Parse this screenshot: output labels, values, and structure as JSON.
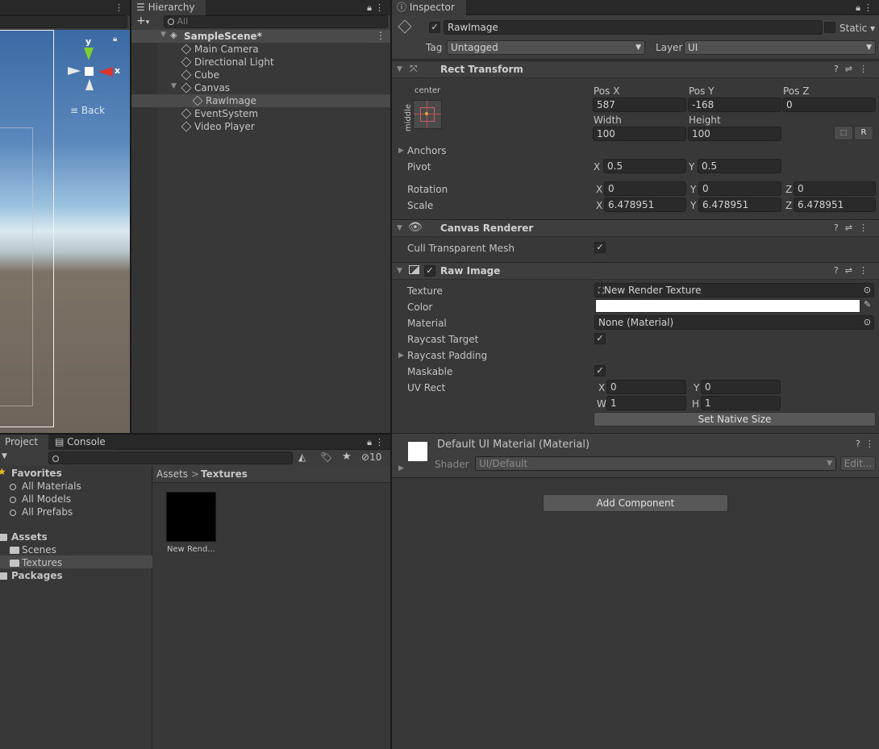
{
  "scene": {
    "axis_y": "y",
    "axis_x": "x",
    "back_label": "Back"
  },
  "hierarchy": {
    "tab": "Hierarchy",
    "search_placeholder": "All",
    "scene_name": "SampleScene*",
    "items": [
      {
        "label": "Main Camera"
      },
      {
        "label": "Directional Light"
      },
      {
        "label": "Cube"
      },
      {
        "label": "Canvas"
      },
      {
        "label": "RawImage"
      },
      {
        "label": "EventSystem"
      },
      {
        "label": "Video Player"
      }
    ]
  },
  "inspector": {
    "tab": "Inspector",
    "object_name": "RawImage",
    "static_label": "Static",
    "tag_label": "Tag",
    "tag_value": "Untagged",
    "layer_label": "Layer",
    "layer_value": "UI",
    "rect_transform": {
      "title": "Rect Transform",
      "anchor_h": "center",
      "anchor_v": "middle",
      "pos_x_label": "Pos X",
      "pos_y_label": "Pos Y",
      "pos_z_label": "Pos Z",
      "pos_x": "587",
      "pos_y": "-168",
      "pos_z": "0",
      "width_label": "Width",
      "height_label": "Height",
      "width": "100",
      "height": "100",
      "r_button": "R",
      "anchors_label": "Anchors",
      "pivot_label": "Pivot",
      "pivot_x": "0.5",
      "pivot_y": "0.5",
      "rotation_label": "Rotation",
      "rot_x": "0",
      "rot_y": "0",
      "rot_z": "0",
      "scale_label": "Scale",
      "scale_x": "6.478951",
      "scale_y": "6.478951",
      "scale_z": "6.478951",
      "x": "X",
      "y": "Y",
      "z": "Z"
    },
    "canvas_renderer": {
      "title": "Canvas Renderer",
      "cull_label": "Cull Transparent Mesh"
    },
    "raw_image": {
      "title": "Raw Image",
      "texture_label": "Texture",
      "texture_value": "New Render Texture",
      "color_label": "Color",
      "color_value": "#ffffff",
      "material_label": "Material",
      "material_value": "None (Material)",
      "raycast_target_label": "Raycast Target",
      "raycast_padding_label": "Raycast Padding",
      "maskable_label": "Maskable",
      "uv_rect_label": "UV Rect",
      "uv_x": "0",
      "uv_y": "0",
      "uv_w": "1",
      "uv_h": "1",
      "x": "X",
      "y": "Y",
      "w": "W",
      "h": "H",
      "set_native_size": "Set Native Size"
    },
    "material": {
      "name": "Default UI Material (Material)",
      "shader_label": "Shader",
      "shader_value": "UI/Default",
      "edit_button": "Edit..."
    },
    "add_component": "Add Component"
  },
  "project": {
    "tab_project": "Project",
    "tab_console": "Console",
    "hidden_count": "10",
    "favorites_label": "Favorites",
    "favorites": [
      {
        "label": "All Materials"
      },
      {
        "label": "All Models"
      },
      {
        "label": "All Prefabs"
      }
    ],
    "assets_label": "Assets",
    "asset_folders": [
      {
        "label": "Scenes"
      },
      {
        "label": "Textures"
      }
    ],
    "packages_label": "Packages",
    "breadcrumb_root": "Assets",
    "breadcrumb_sep": ">",
    "breadcrumb_current": "Textures",
    "asset_item": "New Rend..."
  }
}
